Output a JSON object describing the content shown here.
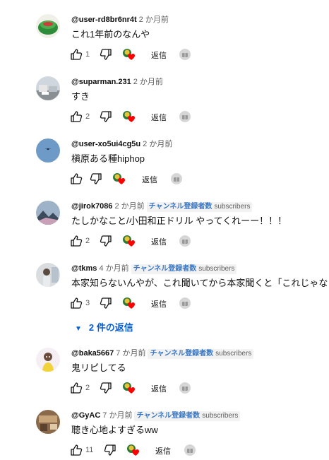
{
  "comments": [
    {
      "author": "@user-rd8br6nr4t",
      "time": "2 か月前",
      "text": "これ1年前のなんや",
      "likes": "1",
      "reply_label": "返信",
      "avatar": "green-cup-photo"
    },
    {
      "author": "@suparman.231",
      "time": "2 か月前",
      "text": "すき",
      "likes": "2",
      "reply_label": "返信",
      "avatar": "building-photo"
    },
    {
      "author": "@user-xo5ui4cg5u",
      "time": "2 か月前",
      "text": "槇原ある種hiphop",
      "likes": "",
      "reply_label": "返信",
      "avatar": "blue-sky-bird-photo"
    },
    {
      "author": "@jirok7086",
      "time": "2 か月前",
      "badge_jp": "チャンネル登録者数",
      "badge_en": "subscribers",
      "text": "たしかなこと/小田和正ドリル やってくれーー！！！",
      "likes": "2",
      "reply_label": "返信",
      "avatar": "mountain-photo"
    },
    {
      "author": "@tkms",
      "time": "4 か月前",
      "badge_jp": "チャンネル登録者数",
      "badge_en": "subscribers",
      "text": "本家知らないんやが、これ聞いてから本家聞くと「これじゃない",
      "likes": "3",
      "reply_label": "返信",
      "avatar": "person-photo",
      "replies_label": "2 件の返信"
    },
    {
      "author": "@baka5667",
      "time": "7 か月前",
      "badge_jp": "チャンネル登録者数",
      "badge_en": "subscribers",
      "text": "鬼リピしてる",
      "likes": "2",
      "reply_label": "返信",
      "avatar": "character-illustration"
    },
    {
      "author": "@GyAC",
      "time": "7 か月前",
      "badge_jp": "チャンネル登録者数",
      "badge_en": "subscribers",
      "text": "聴き心地よすぎるww",
      "likes": "11",
      "reply_label": "返信",
      "avatar": "room-photo"
    }
  ],
  "icons": {
    "like": "thumbs-up-icon",
    "dislike": "thumbs-down-icon",
    "creator_heart": "creator-heart-icon",
    "gift": "gift-icon"
  },
  "colors": {
    "link_blue": "#065fd4",
    "badge_blue": "#3a78c4",
    "heart_red": "#ff0000",
    "secondary_text": "#606060"
  }
}
